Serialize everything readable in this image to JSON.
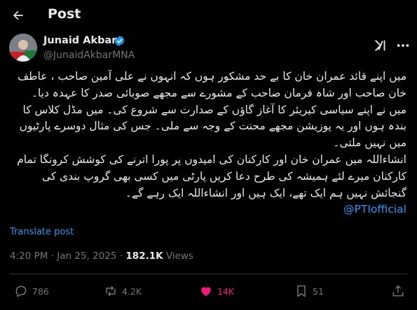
{
  "header": {
    "title": "Post"
  },
  "author": {
    "name": "Junaid Akbar",
    "handle": "@JunaidAkbarMNA"
  },
  "tweet": {
    "lines": [
      "میں اپنے قائد عمران خان کا بے حد مشکور ہوں کہ انہوں نے علی آمین صاحب ، عاطف",
      "خان صاحب اور شاہ فرمان صاحب کے مشورے سے مجھے صوبائی صدر کا عہدہ دیا۔",
      "میں نے اپنے سیاسی کیریئر کا آغاز گاؤں کے صدارت سے شروع کی۔ میں مڈل کلاس کا",
      "بندہ ہوں اور یہ پوزیشن مجھے محنت کے وجہ سے ملی۔ جس کی مثال دوسرے پارٹیوں",
      "میں نہیں ملتی۔",
      "انشاءاللہ میں عمران خان اور کارکنان کی امیدوں پر پورا اترنے کی کوشش کرونگا تمام",
      "کارکنان میرے لئے ہمیشہ کی طرح دعا کریں پارٹی میں کسی بھی گروپ بندی کی",
      "گنجائش نہیں ہم ایک تھے، ایک ہیں اور انشاءاللہ ایک رہے گے۔"
    ],
    "mention": "@PTIofficial"
  },
  "translate_label": "Translate post",
  "meta": {
    "time": "4:20 PM",
    "separator": "·",
    "date": "Jan 25, 2025",
    "views_count": "182.1K",
    "views_label": "Views"
  },
  "actions": {
    "replies": "786",
    "reposts": "4.2K",
    "likes": "14K",
    "bookmarks": "51"
  },
  "colors": {
    "background": "#000000",
    "text": "#e7e9ea",
    "muted": "#71767b",
    "link": "#1d9bf0",
    "like": "#f91880",
    "divider": "#2f3336"
  }
}
